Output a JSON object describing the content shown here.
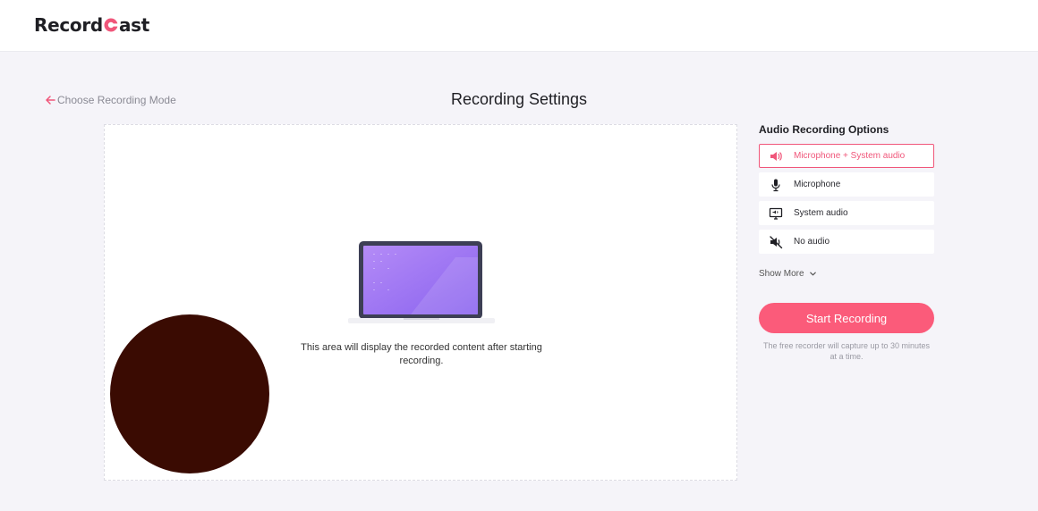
{
  "header": {
    "logo_before": "Record",
    "logo_after": "ast",
    "brand_color": "#f0567a"
  },
  "nav": {
    "back_label": "Choose Recording Mode"
  },
  "page": {
    "title": "Recording Settings"
  },
  "preview": {
    "message": "This area will display the recorded content after starting recording.",
    "webcam_color": "#3a0b02"
  },
  "audio": {
    "title": "Audio Recording Options",
    "options": [
      {
        "label": "Microphone + System audio",
        "icon": "speaker-icon",
        "selected": true
      },
      {
        "label": "Microphone",
        "icon": "microphone-icon",
        "selected": false
      },
      {
        "label": "System audio",
        "icon": "monitor-audio-icon",
        "selected": false
      },
      {
        "label": "No audio",
        "icon": "mute-icon",
        "selected": false
      }
    ],
    "show_more_label": "Show More"
  },
  "actions": {
    "start_label": "Start Recording",
    "note": "The free recorder will capture up to 30 minutes at a time."
  }
}
